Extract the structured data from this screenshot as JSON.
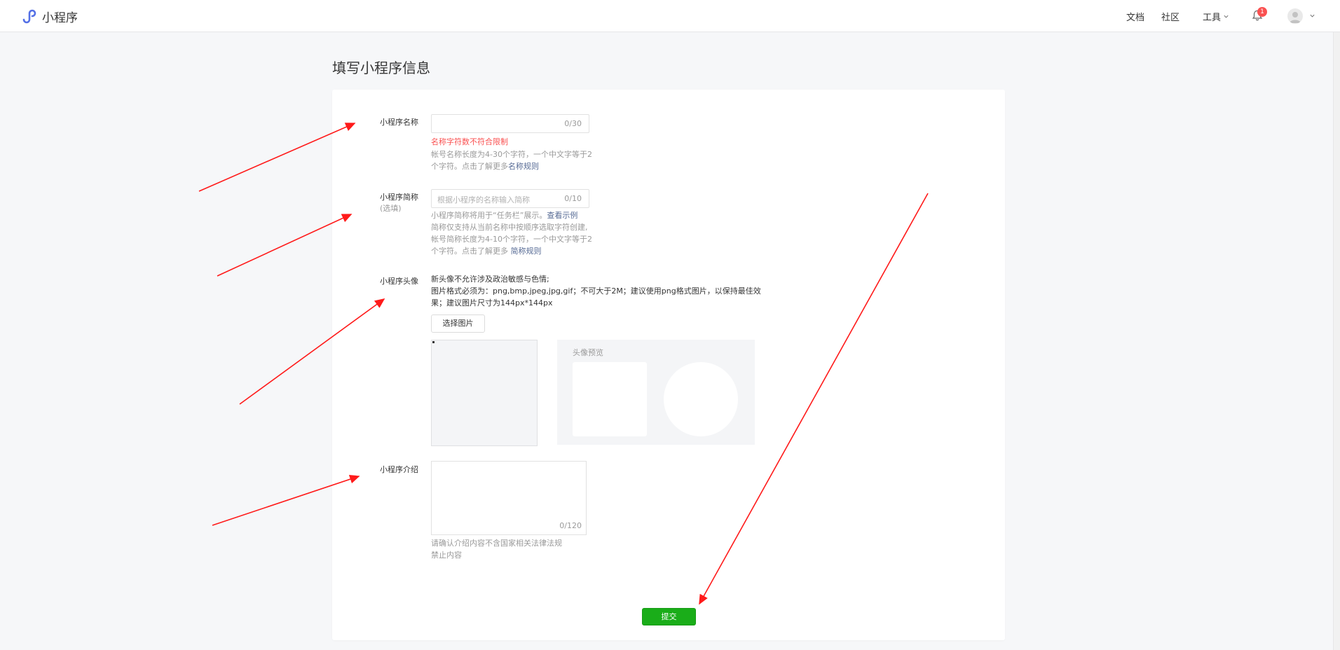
{
  "header": {
    "logo_text": "小程序",
    "nav": {
      "docs": "文档",
      "community": "社区",
      "tools": "工具"
    },
    "notification_count": "1"
  },
  "page": {
    "title": "填写小程序信息"
  },
  "form": {
    "name": {
      "label": "小程序名称",
      "counter": "0/30",
      "error": "名称字符数不符合限制",
      "hint_line1": "帐号名称长度为4-30个字符，一个中文字等于2",
      "hint_line2_prefix": "个字符。点击了解更多",
      "hint_link": "名称规则"
    },
    "short_name": {
      "label": "小程序简称",
      "label_sub": "(选填)",
      "placeholder": "根据小程序的名称输入简称",
      "counter": "0/10",
      "hint_line1_prefix": "小程序简称将用于“任务栏”展示。",
      "hint_line1_link": "查看示例",
      "hint_line2": "简称仅支持从当前名称中按顺序选取字符创建,",
      "hint_line3": "帐号简称长度为4-10个字符，一个中文字等于2",
      "hint_line4_prefix": "个字符。点击了解更多 ",
      "hint_line4_link": "简称规则"
    },
    "avatar": {
      "label": "小程序头像",
      "desc_line1": "新头像不允许涉及政治敏感与色情;",
      "desc_line2": "图片格式必须为：png,bmp,jpeg,jpg,gif；不可大于2M；建议使用png格式图片，以保持最佳效",
      "desc_line3": "果；建议图片尺寸为144px*144px",
      "select_button": "选择图片",
      "preview_title": "头像预览"
    },
    "intro": {
      "label": "小程序介绍",
      "counter": "0/120",
      "hint_line1": "请确认介绍内容不含国家相关法律法规",
      "hint_line2": "禁止内容"
    },
    "submit_label": "提交"
  },
  "colors": {
    "primary": "#1aad19",
    "error": "#fa5151",
    "link": "#576b95",
    "annotation_arrow": "#ff1a1a",
    "logo": "#5470e6"
  }
}
